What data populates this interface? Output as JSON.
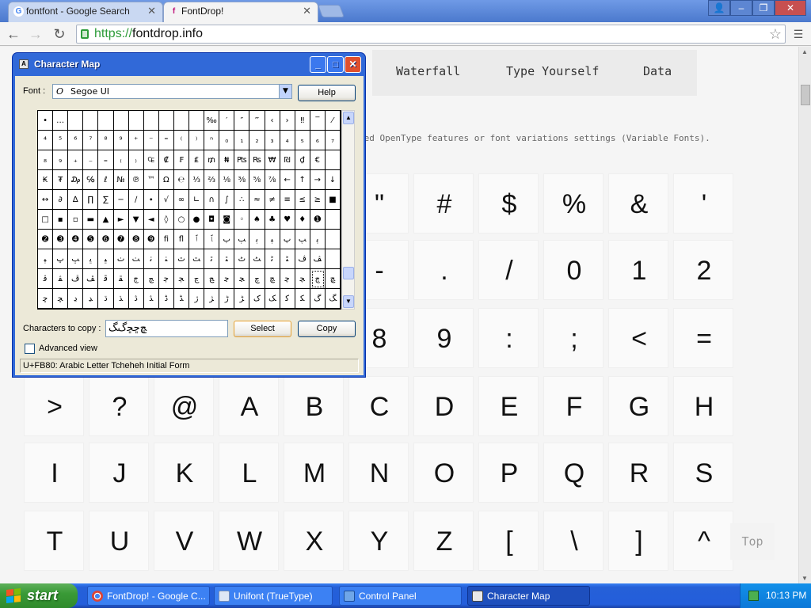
{
  "browser": {
    "tabs": [
      {
        "title": "fontfont - Google Search",
        "favicon": "G"
      },
      {
        "title": "FontDrop!",
        "favicon": "fontdrop-icon"
      }
    ],
    "url_scheme": "https://",
    "url_host": "fontdrop.info"
  },
  "page": {
    "nav": [
      "Waterfall",
      "Type Yourself",
      "Data"
    ],
    "subtext": "ted OpenType features or font variations settings (Variable Fonts).",
    "glyphs_partial": [
      "\"",
      "#",
      "$",
      "%",
      "&",
      "'",
      "-",
      ".",
      "/",
      "0",
      "1",
      "2",
      "8",
      "9",
      ":",
      ";",
      "<",
      "="
    ],
    "glyph_rows": [
      [
        ">",
        "?",
        "@",
        "A",
        "B",
        "C",
        "D",
        "E",
        "F",
        "G",
        "H"
      ],
      [
        "I",
        "J",
        "K",
        "L",
        "M",
        "N",
        "O",
        "P",
        "Q",
        "R",
        "S"
      ],
      [
        "T",
        "U",
        "V",
        "W",
        "X",
        "Y",
        "Z",
        "[",
        "\\",
        "]",
        "^"
      ]
    ],
    "top_button": "Top"
  },
  "charmap": {
    "title": "Character Map",
    "font_label": "Font :",
    "font_value": "Segoe UI",
    "help_button": "Help",
    "grid": [
      [
        "•",
        "…",
        "",
        "",
        "",
        "",
        "",
        "",
        "",
        "",
        "",
        "‰",
        "′",
        "″",
        "‴",
        "‹",
        "›",
        "‼",
        "‾",
        "⁄"
      ],
      [
        "⁴",
        "⁵",
        "⁶",
        "⁷",
        "⁸",
        "⁹",
        "⁺",
        "⁻",
        "⁼",
        "⁽",
        "⁾",
        "ⁿ",
        "₀",
        "₁",
        "₂",
        "₃",
        "₄",
        "₅",
        "₆",
        "₇"
      ],
      [
        "₈",
        "₉",
        "₊",
        "₋",
        "₌",
        "₍",
        "₎",
        "₠",
        "₡",
        "₣",
        "₤",
        "₥",
        "₦",
        "₧",
        "₨",
        "₩",
        "₪",
        "₫",
        "€",
        ""
      ],
      [
        "₭",
        "₮",
        "₯",
        "℅",
        "ℓ",
        "№",
        "℗",
        "™",
        "Ω",
        "℮",
        "⅓",
        "⅔",
        "⅛",
        "⅜",
        "⅝",
        "⅞",
        "←",
        "↑",
        "→",
        "↓"
      ],
      [
        "↔",
        "∂",
        "∆",
        "∏",
        "∑",
        "−",
        "∕",
        "∙",
        "√",
        "∞",
        "∟",
        "∩",
        "∫",
        "∴",
        "≈",
        "≠",
        "≡",
        "≤",
        "≥",
        "■"
      ],
      [
        "□",
        "▪",
        "▫",
        "▬",
        "▲",
        "►",
        "▼",
        "◄",
        "◊",
        "○",
        "●",
        "◘",
        "◙",
        "◦",
        "♠",
        "♣",
        "♥",
        "♦",
        "➊",
        ""
      ],
      [
        "➋",
        "➌",
        "➍",
        "➎",
        "➏",
        "➐",
        "➑",
        "➒",
        "ﬁ",
        "ﬂ",
        "ﭐ",
        "ﭑ",
        "ﭒ",
        "ﭓ",
        "ﭔ",
        "ﭕ",
        "ﭖ",
        "ﭗ",
        "ﭘ",
        ""
      ],
      [
        "ﭙ",
        "ﭚ",
        "ﭛ",
        "ﭜ",
        "ﭝ",
        "ﭞ",
        "ﭟ",
        "ﭠ",
        "ﭡ",
        "ﭢ",
        "ﭣ",
        "ﭤ",
        "ﭥ",
        "ﭦ",
        "ﭧ",
        "ﭨ",
        "ﭩ",
        "ﭪ",
        "ﭫ",
        ""
      ],
      [
        "ﭬ",
        "ﭭ",
        "ﭮ",
        "ﭯ",
        "ﭰ",
        "ﭱ",
        "ﭲ",
        "ﭳ",
        "ﭴ",
        "ﭵ",
        "ﭶ",
        "ﭷ",
        "ﭸ",
        "ﭹ",
        "ﭺ",
        "ﭻ",
        "ﭼ",
        "ﭽ",
        "ﭾ",
        "ﭿ"
      ],
      [
        "ﮀ",
        "ﮁ",
        "ﮂ",
        "ﮃ",
        "ﮄ",
        "ﮅ",
        "ﮆ",
        "ﮇ",
        "ﮈ",
        "ﮉ",
        "ﮊ",
        "ﮋ",
        "ﮌ",
        "ﮍ",
        "ﮎ",
        "ﮏ",
        "ﮐ",
        "ﮑ",
        "ﮒ",
        "ﮓ"
      ]
    ],
    "chars_label": "Characters to copy :",
    "chars_value": "ﭿﮀﮁﮒﮓ",
    "select_button": "Select",
    "copy_button": "Copy",
    "advanced_label": "Advanced view",
    "status": "U+FB80: Arabic Letter Tcheheh Initial Form"
  },
  "taskbar": {
    "start": "start",
    "tasks": [
      {
        "label": "FontDrop! - Google C...",
        "icon": "chrome-icon"
      },
      {
        "label": "Unifont (TrueType)",
        "icon": "font-icon"
      },
      {
        "label": "Control Panel",
        "icon": "control-panel-icon"
      },
      {
        "label": "Character Map",
        "icon": "charmap-icon"
      }
    ],
    "clock": "10:13 PM"
  }
}
